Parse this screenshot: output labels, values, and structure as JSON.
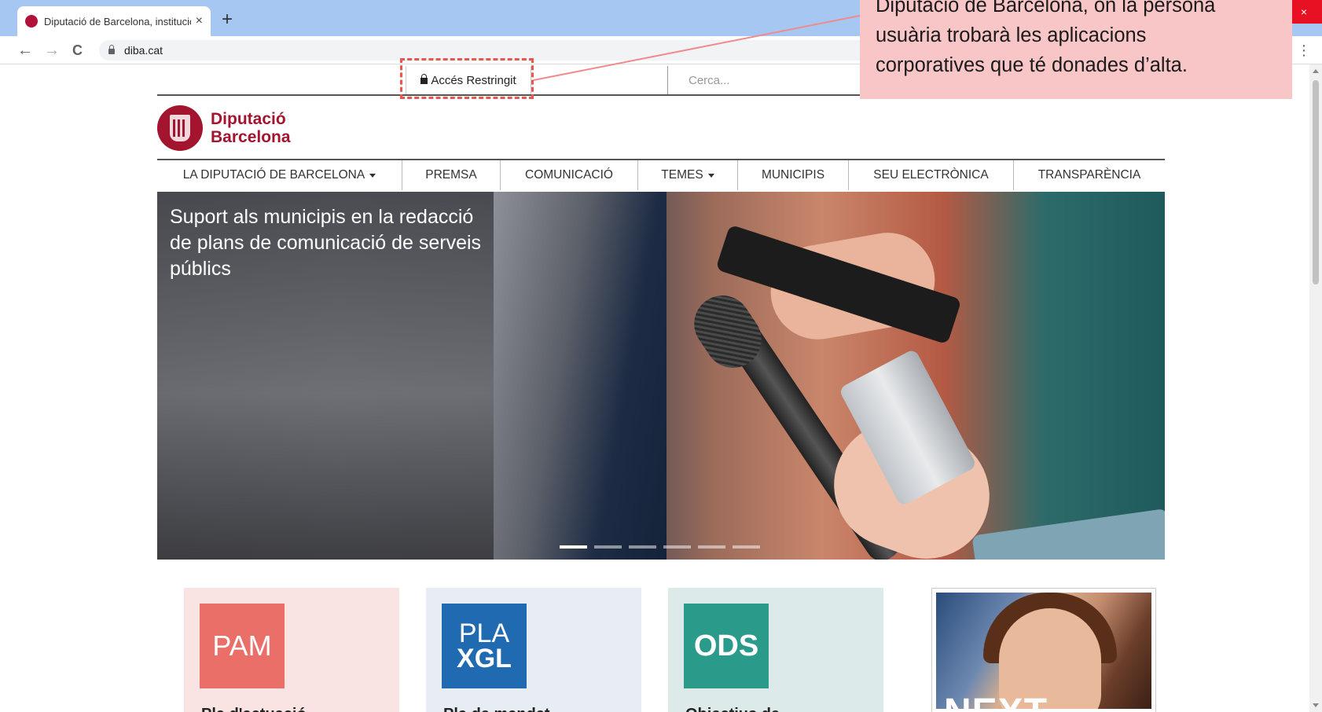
{
  "browser": {
    "tab_title": "Diputació de Barcelona, institució",
    "tab_close": "×",
    "new_tab": "+",
    "address": "diba.cat",
    "win_close": "×",
    "menu": "⋮",
    "back": "←",
    "forward": "→",
    "reload": "C"
  },
  "site": {
    "topbar": {
      "restricted_label": "Accés Restringit",
      "search_placeholder": "Cerca..."
    },
    "logo": {
      "line1": "Diputació",
      "line2": "Barcelona"
    },
    "nav": [
      {
        "label": "LA DIPUTACIÓ DE BARCELONA",
        "has_dropdown": true
      },
      {
        "label": "PREMSA",
        "has_dropdown": false
      },
      {
        "label": "COMUNICACIÓ",
        "has_dropdown": false
      },
      {
        "label": "TEMES",
        "has_dropdown": true
      },
      {
        "label": "MUNICIPIS",
        "has_dropdown": false
      },
      {
        "label": "SEU ELECTRÒNICA",
        "has_dropdown": false
      },
      {
        "label": "TRANSPARÈNCIA",
        "has_dropdown": false
      }
    ],
    "hero": {
      "caption": "Suport als municipis en la redacció de plans de comunicació de serveis públics",
      "slides": 6,
      "active_slide": 1
    },
    "cards": [
      {
        "badge": "PAM",
        "title": "Pla d'actuació",
        "bg": "#f9e4e3",
        "badge_color": "#ea6f68"
      },
      {
        "badge_line1": "PLA",
        "badge_line2": "XGL",
        "title": "Pla de mandat",
        "bg": "#e7edf3",
        "badge_color": "#1f6ab0"
      },
      {
        "badge": "ODS",
        "title": "Objectius de",
        "bg": "#dcebea",
        "badge_color": "#2a9a8a"
      }
    ],
    "photo_card_overlay": "NEXT"
  },
  "callout": {
    "text_line1": "Diputació de Barcelona, on la persona",
    "text_line2": "usuària trobarà les aplicacions",
    "text_line3": "corporatives que té donades d’alta."
  },
  "colors": {
    "brand": "#a3142f",
    "highlight": "#e8564f",
    "callout_bg": "#f9c6c8"
  }
}
